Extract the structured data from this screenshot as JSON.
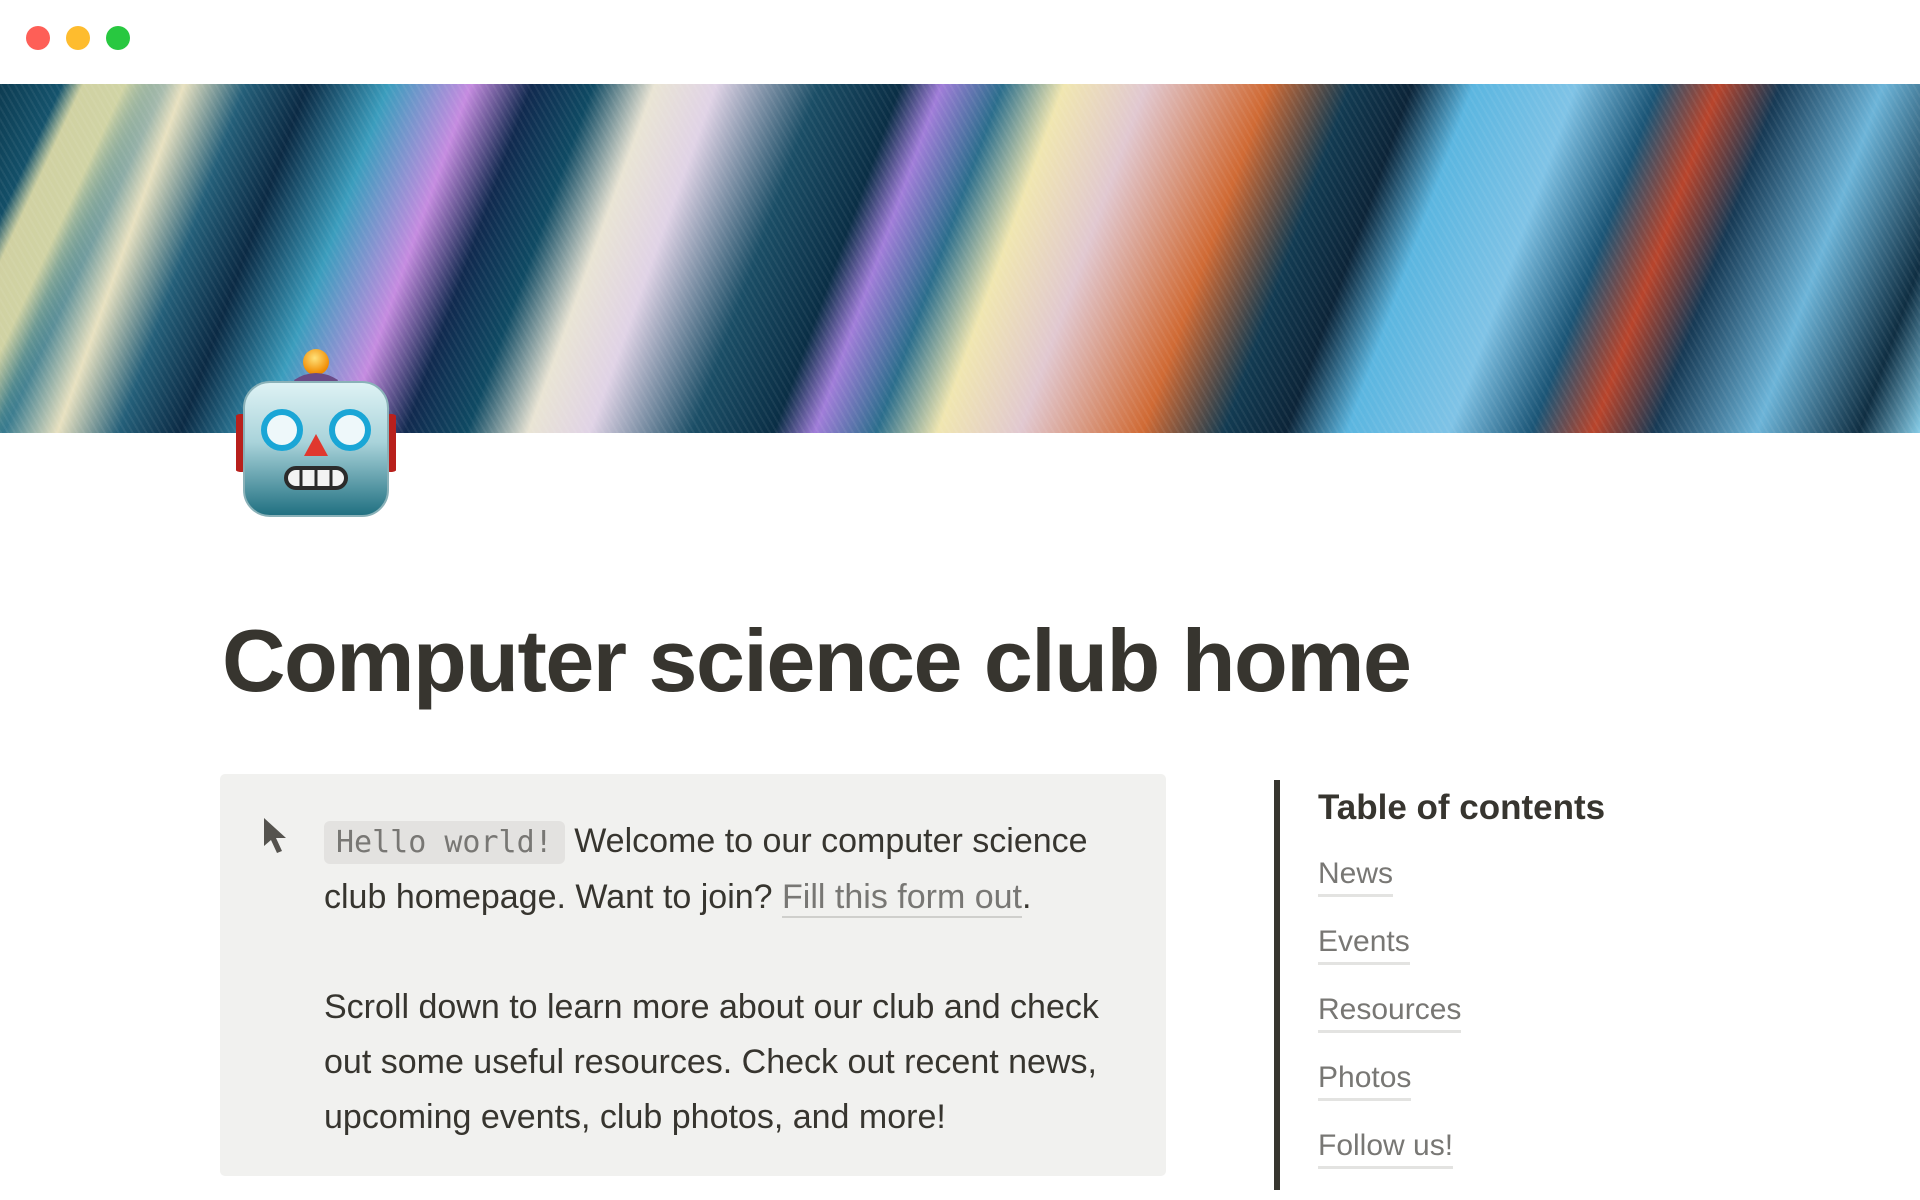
{
  "window": {
    "controls": [
      "close",
      "minimize",
      "maximize"
    ],
    "colors": {
      "close": "#fe5f57",
      "minimize": "#febc2e",
      "maximize": "#28c840"
    }
  },
  "page": {
    "cover": "abstract-iridescent-cover",
    "icon": "robot-face-icon",
    "title": "Computer science club home"
  },
  "callout": {
    "icon": "cursor-arrow-icon",
    "code_text": "Hello world!",
    "text_1": " Welcome to our computer science club homepage. Want to join? ",
    "link_text": "Fill this form out",
    "text_1_end": ".",
    "paragraph_2": "Scroll down to learn more about our club and check out some useful resources. Check out recent news, upcoming events, club photos, and more!"
  },
  "toc": {
    "heading": "Table of contents",
    "items": [
      {
        "label": "News"
      },
      {
        "label": "Events"
      },
      {
        "label": "Resources"
      },
      {
        "label": "Photos"
      },
      {
        "label": "Follow us!"
      }
    ]
  }
}
